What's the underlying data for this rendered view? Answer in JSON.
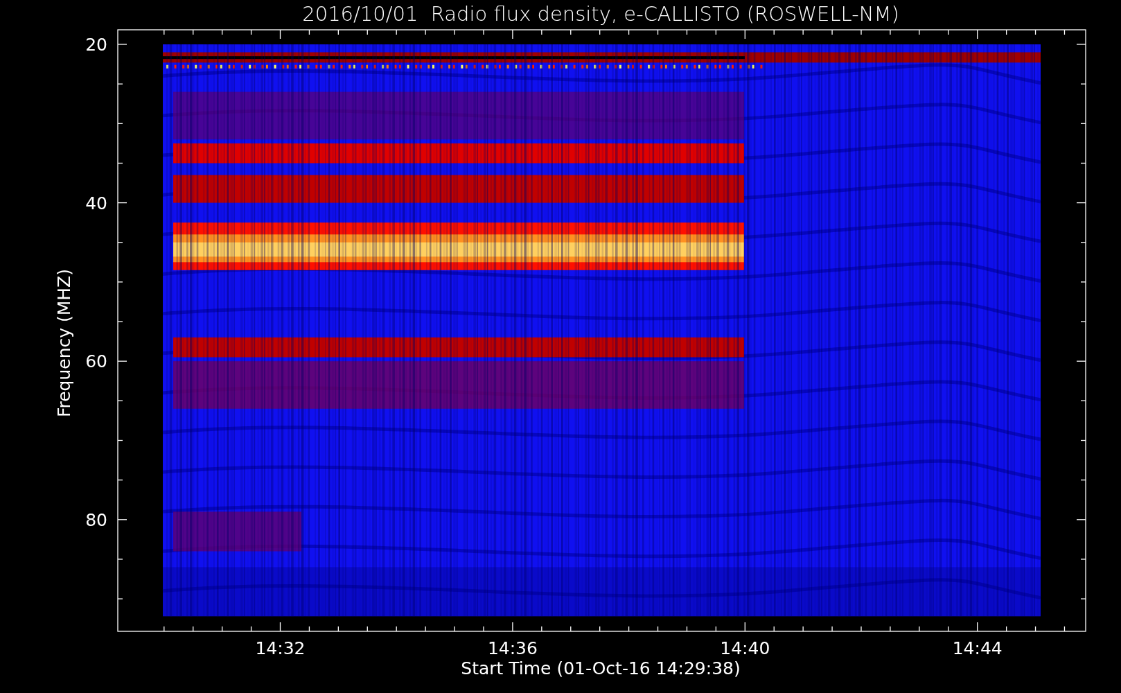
{
  "chart": {
    "title": "2016/10/01  Radio flux density, e-CALLISTO (ROSWELL-NM)",
    "ylabel": "Frequency (MHZ)",
    "xlabel": "Start Time (01-Oct-16 14:29:38)",
    "yticks": [
      "20",
      "40",
      "60",
      "80"
    ],
    "xticks": [
      "14:32",
      "14:36",
      "14:40",
      "14:44"
    ]
  }
}
